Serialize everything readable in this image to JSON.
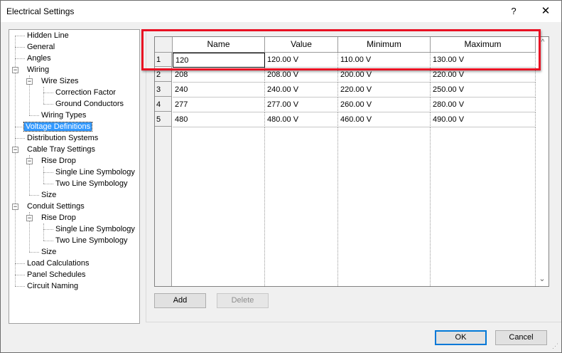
{
  "window": {
    "title": "Electrical Settings",
    "help": "?",
    "close": "✕"
  },
  "tree": {
    "items": [
      {
        "label": "Hidden Line"
      },
      {
        "label": "General"
      },
      {
        "label": "Angles"
      },
      {
        "label": "Wiring",
        "expander": "−"
      },
      {
        "label": "Wire Sizes",
        "expander": "−"
      },
      {
        "label": "Correction Factor"
      },
      {
        "label": "Ground Conductors"
      },
      {
        "label": "Wiring Types"
      },
      {
        "label": "Voltage Definitions",
        "selected": true
      },
      {
        "label": "Distribution Systems"
      },
      {
        "label": "Cable Tray Settings",
        "expander": "−"
      },
      {
        "label": "Rise Drop",
        "expander": "−"
      },
      {
        "label": "Single Line Symbology"
      },
      {
        "label": "Two Line Symbology"
      },
      {
        "label": "Size"
      },
      {
        "label": "Conduit Settings",
        "expander": "−"
      },
      {
        "label": "Rise Drop",
        "expander": "−"
      },
      {
        "label": "Single Line Symbology"
      },
      {
        "label": "Two Line Symbology"
      },
      {
        "label": "Size"
      },
      {
        "label": "Load Calculations"
      },
      {
        "label": "Panel Schedules"
      },
      {
        "label": "Circuit Naming"
      }
    ]
  },
  "table": {
    "columns": [
      "Name",
      "Value",
      "Minimum",
      "Maximum"
    ],
    "rows": [
      {
        "num": "1",
        "name": "120",
        "value": "120.00 V",
        "minimum": "110.00 V",
        "maximum": "130.00 V"
      },
      {
        "num": "2",
        "name": "208",
        "value": "208.00 V",
        "minimum": "200.00 V",
        "maximum": "220.00 V"
      },
      {
        "num": "3",
        "name": "240",
        "value": "240.00 V",
        "minimum": "220.00 V",
        "maximum": "250.00 V"
      },
      {
        "num": "4",
        "name": "277",
        "value": "277.00 V",
        "minimum": "260.00 V",
        "maximum": "280.00 V"
      },
      {
        "num": "5",
        "name": "480",
        "value": "480.00 V",
        "minimum": "460.00 V",
        "maximum": "490.00 V"
      }
    ],
    "scroll_up": "^",
    "scroll_down": "⌄"
  },
  "buttons": {
    "add": "Add",
    "delete": "Delete",
    "ok": "OK",
    "cancel": "Cancel"
  },
  "colors": {
    "highlight": "#e81123",
    "selection": "#3399ff",
    "ok_border": "#0078d7"
  }
}
